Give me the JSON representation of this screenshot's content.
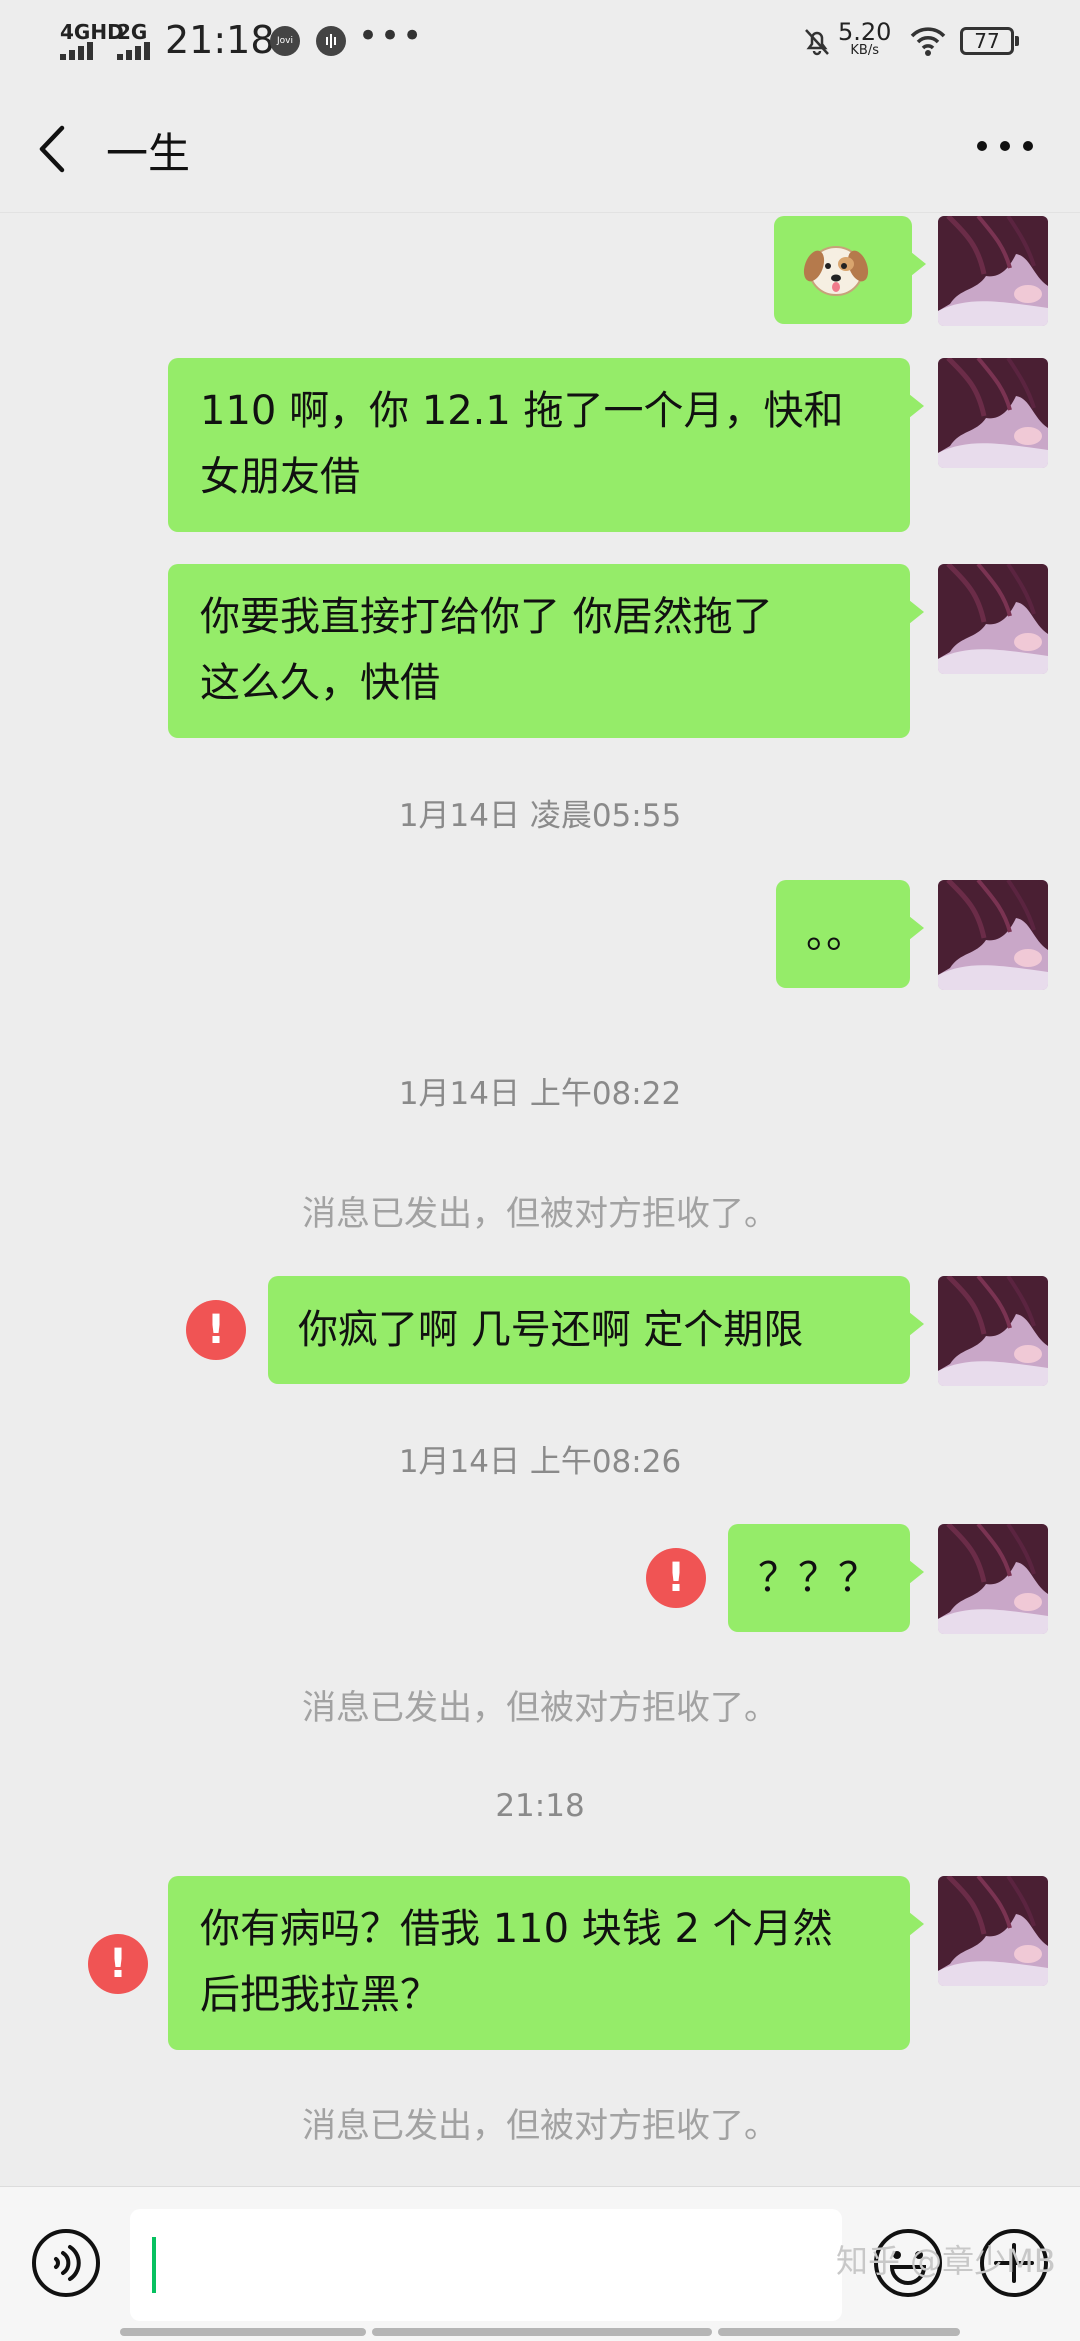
{
  "status_bar": {
    "network_1": "4GHD",
    "network_2": "2G",
    "time": "21:18",
    "icon_1_label": "Jovi",
    "speed_value": "5.20",
    "speed_unit": "KB/s",
    "battery": "77"
  },
  "header": {
    "title": "一生",
    "back_icon": "chevron-left-icon",
    "more_icon": "more-dots-icon"
  },
  "messages": [
    {
      "type": "sent",
      "text": "🐶",
      "failed": false
    },
    {
      "type": "sent",
      "lines": [
        "110 啊，你 12.1 拖了一个月，快和",
        "女朋友借"
      ],
      "failed": false
    },
    {
      "type": "sent",
      "lines": [
        "你要我直接打给你了 你居然拖了",
        "这么久，快借"
      ],
      "failed": false
    },
    {
      "type": "timestamp",
      "text": "1月14日 凌晨05:55"
    },
    {
      "type": "sent",
      "text": "。。",
      "failed": false
    },
    {
      "type": "timestamp",
      "text": "1月14日 上午08:22"
    },
    {
      "type": "system",
      "text": "消息已发出，但被对方拒收了。"
    },
    {
      "type": "sent",
      "text": "你疯了啊 几号还啊 定个期限",
      "failed": true
    },
    {
      "type": "timestamp",
      "text": "1月14日 上午08:26"
    },
    {
      "type": "sent",
      "text": "？？？",
      "failed": true
    },
    {
      "type": "system",
      "text": "消息已发出，但被对方拒收了。"
    },
    {
      "type": "timestamp",
      "text": "21:18"
    },
    {
      "type": "sent",
      "lines": [
        "你有病吗？借我 110 块钱 2 个月然",
        "后把我拉黑？"
      ],
      "failed": true
    },
    {
      "type": "system",
      "text": "消息已发出，但被对方拒收了。"
    }
  ],
  "error_mark": "!",
  "input_bar": {
    "voice_icon": "voice-icon",
    "emoji_icon": "emoji-icon",
    "plus_icon": "plus-icon",
    "value": ""
  },
  "watermark": "知乎 @章少MB",
  "colors": {
    "background": "#ededed",
    "bubble_sent": "#95ec69",
    "error": "#f05454",
    "caret": "#07c160"
  }
}
